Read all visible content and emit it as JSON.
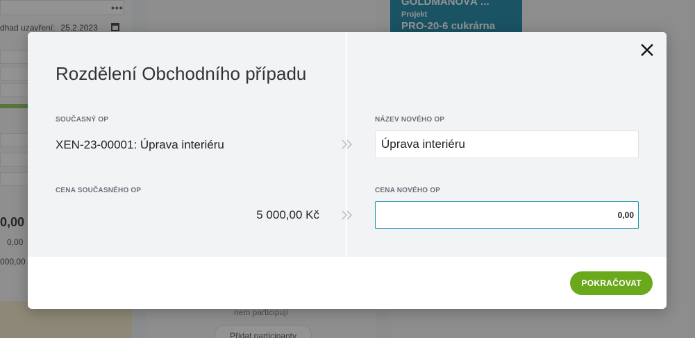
{
  "background": {
    "menu_dots": "•••",
    "closing_label": "dhad uzavření:",
    "closing_value": "25.2.2023",
    "amount_big": "0,00",
    "amount_small": "0,00",
    "amount_total": "000,00",
    "card_title": "GOLDMANOVÁ ...",
    "card_project_label": "Projekt",
    "card_project_value": "PRO-20-6 cukrárna",
    "no_participants": "nem participují",
    "add_participants": "Přidat participanty"
  },
  "modal": {
    "title": "Rozdělení Obchodního případu",
    "current_op_label": "Současný OP",
    "current_op_value": "XEN-23-00001: Úprava interiéru",
    "current_price_label": "Cena současného OP",
    "current_price_value": "5 000,00 Kč",
    "new_name_label": "Název nového OP",
    "new_name_value": "Úprava interiéru",
    "new_price_label": "Cena nového OP",
    "new_price_value": "0,00",
    "continue_label": "POKRAČOVAT"
  },
  "colors": {
    "accent_green": "#6aa91b",
    "focus_border": "#1a8fa6",
    "card_teal": "#0d7fa0"
  },
  "icons": {
    "close": "close-icon",
    "arrows": "double-chevron-right-icon",
    "calendar": "calendar-icon"
  }
}
